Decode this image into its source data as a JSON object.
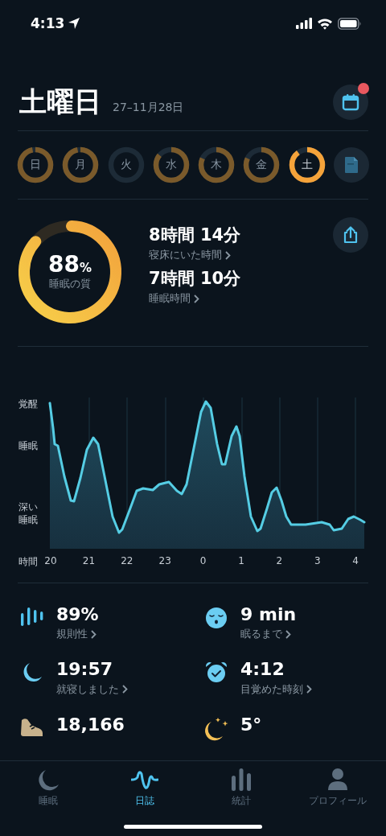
{
  "status_bar": {
    "time": "4:13"
  },
  "header": {
    "title": "土曜日",
    "date": "27–11月28日",
    "calendar_badge": true
  },
  "days": [
    {
      "label": "日",
      "level": 0.97,
      "selected": false
    },
    {
      "label": "月",
      "level": 0.97,
      "selected": false
    },
    {
      "label": "火",
      "selected": false
    },
    {
      "label": "水",
      "level": 0.86,
      "selected": false
    },
    {
      "label": "木",
      "level": 0.82,
      "selected": false
    },
    {
      "label": "金",
      "level": 0.82,
      "selected": false
    },
    {
      "label": "土",
      "level": 0.9,
      "selected": true
    }
  ],
  "summary": {
    "quality": {
      "value": "88",
      "unit": "%",
      "label": "睡眠の質",
      "level": 0.88
    },
    "metrics": [
      {
        "value": "8時間 14分",
        "label": "寝床にいた時間"
      },
      {
        "value": "7時間 10分",
        "label": "睡眠時間"
      }
    ]
  },
  "chart": {
    "y_labels": [
      "覚醒",
      "睡眠",
      "深い睡眠"
    ],
    "x_title": "時間",
    "x_labels": [
      "20",
      "21",
      "22",
      "23",
      "0",
      "1",
      "2",
      "3",
      "4"
    ]
  },
  "stats": [
    {
      "kind": "regularity",
      "value": "89%",
      "label": "規則性"
    },
    {
      "kind": "latency",
      "value": "9 min",
      "label": "眠るまで"
    },
    {
      "kind": "bedtime",
      "value": "19:57",
      "label": "就寝しました"
    },
    {
      "kind": "wake",
      "value": "4:12",
      "label": "目覚めた時刻"
    },
    {
      "kind": "steps",
      "value": "18,166"
    },
    {
      "kind": "weather",
      "value": "5°"
    }
  ],
  "tab_bar": [
    {
      "label": "睡眠",
      "kind": "moon",
      "selected": false
    },
    {
      "label": "日誌",
      "kind": "wave",
      "selected": true
    },
    {
      "label": "統計",
      "kind": "bars",
      "selected": false
    },
    {
      "label": "プロフィール",
      "kind": "person",
      "selected": false
    }
  ]
}
